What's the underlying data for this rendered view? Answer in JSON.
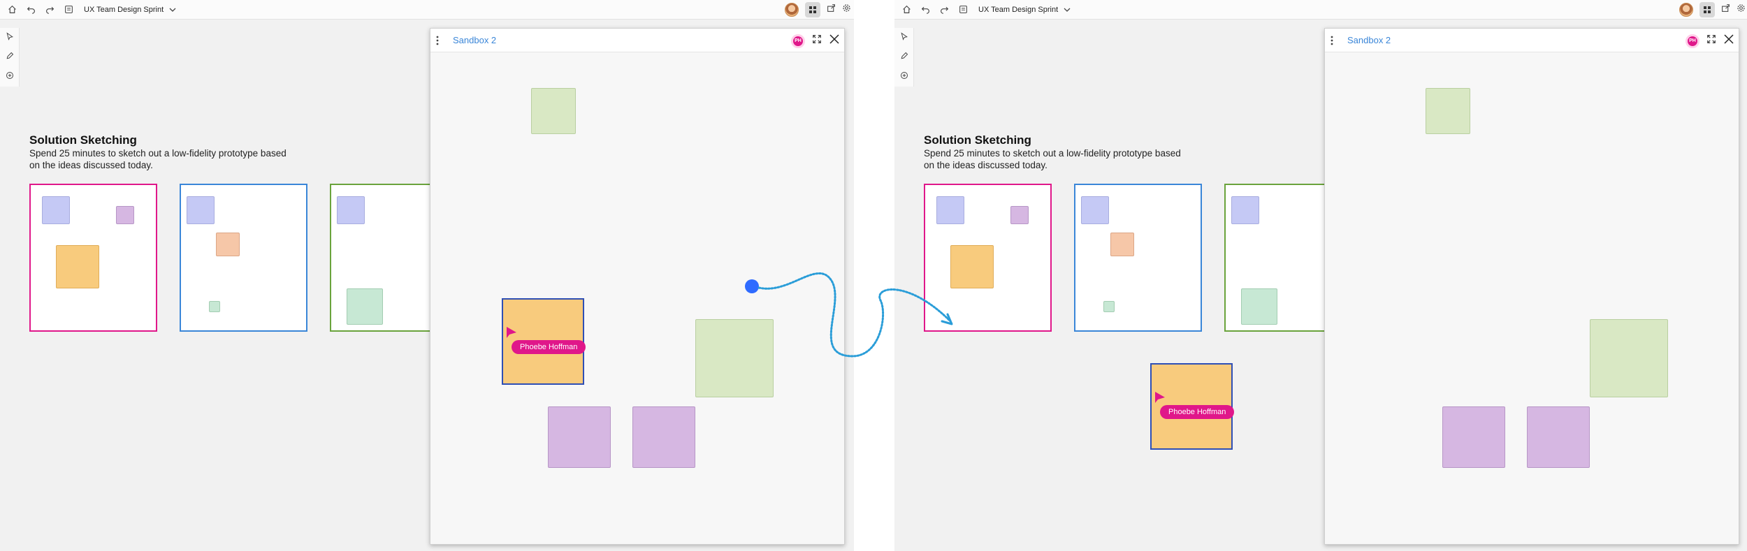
{
  "toolbar": {
    "board_title": "UX Team Design Sprint"
  },
  "section": {
    "heading": "Solution Sketching",
    "description": "Spend 25 minutes to sketch out a low-fidelity prototype based on the ideas discussed today."
  },
  "sandbox": {
    "title": "Sandbox 2",
    "presence_initials": "PH"
  },
  "collaborator": {
    "name": "Phoebe Hoffman"
  },
  "colors": {
    "pink": "#e0178a",
    "blue_border": "#3a86d8",
    "green_border": "#6aa33c",
    "orange_note": "#f8cb7d",
    "purple_note": "#d6b7e2",
    "green_note": "#d9e8c4",
    "periwinkle_note": "#c5c9f5",
    "peach_note": "#f6c7a8",
    "mint_note": "#c7e8d4"
  }
}
